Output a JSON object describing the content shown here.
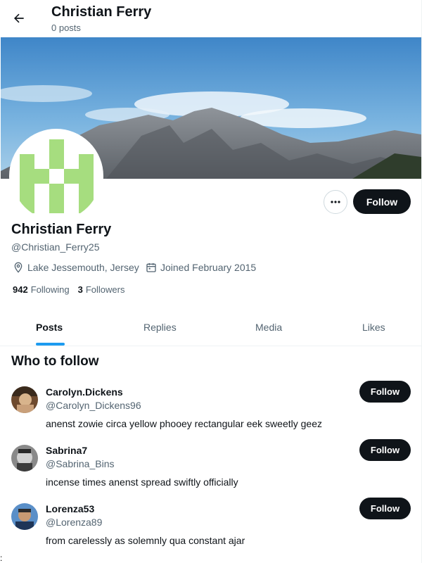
{
  "header": {
    "title": "Christian Ferry",
    "subtitle": "0 posts"
  },
  "profile": {
    "name": "Christian Ferry",
    "handle": "@Christian_Ferry25",
    "location": "Lake Jessemouth, Jersey",
    "joined": "Joined February 2015",
    "following_count": "942",
    "following_label": "Following",
    "followers_count": "3",
    "followers_label": "Followers",
    "follow_label": "Follow",
    "more_label": "•••"
  },
  "tabs": [
    {
      "label": "Posts",
      "active": true
    },
    {
      "label": "Replies",
      "active": false
    },
    {
      "label": "Media",
      "active": false
    },
    {
      "label": "Likes",
      "active": false
    }
  ],
  "who_to_follow": {
    "title": "Who to follow",
    "users": [
      {
        "name": "Carolyn.Dickens",
        "handle": "@Carolyn_Dickens96",
        "bio": "anenst zowie circa yellow phooey rectangular eek sweetly geez",
        "follow_label": "Follow"
      },
      {
        "name": "Sabrina7",
        "handle": "@Sabrina_Bins",
        "bio": "incense times anenst spread swiftly officially",
        "follow_label": "Follow"
      },
      {
        "name": "Lorenza53",
        "handle": "@Lorenza89",
        "bio": "from carelessly as solemnly qua constant ajar",
        "follow_label": "Follow"
      }
    ]
  },
  "stray_text": ":",
  "colors": {
    "accent": "#1d9bf0",
    "button": "#0f1419",
    "muted": "#536471",
    "avatar_pattern": "#a6dd7f"
  }
}
